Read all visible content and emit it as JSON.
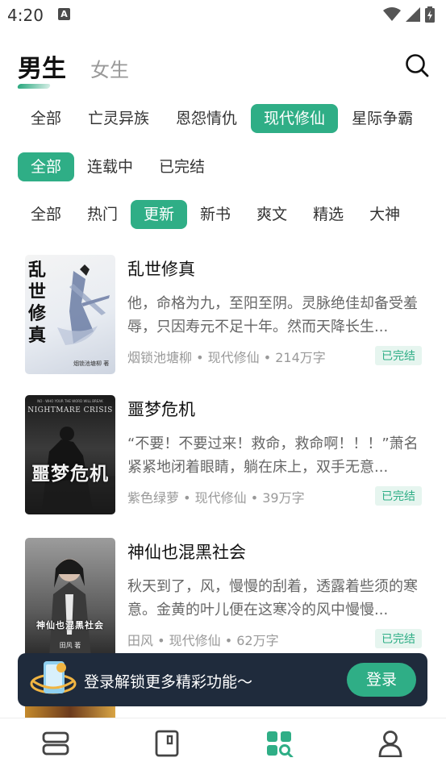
{
  "status_bar": {
    "time": "4:20",
    "notification_icon": "A"
  },
  "gender_tabs": {
    "male": "男生",
    "female": "女生"
  },
  "category_chips": [
    "全部",
    "亡灵异族",
    "恩怨情仇",
    "现代修仙",
    "星际争霸"
  ],
  "category_active_index": 3,
  "status_chips": [
    "全部",
    "连载中",
    "已完结"
  ],
  "status_active_index": 0,
  "sort_chips": [
    "全部",
    "热门",
    "更新",
    "新书",
    "爽文",
    "精选",
    "大神"
  ],
  "sort_active_index": 2,
  "books": [
    {
      "title": "乱世修真",
      "description": "他，命格为九，至阳至阴。灵脉绝佳却备受羞辱，只因寿元不足十年。然而天降长生...",
      "meta": "烟锁池塘柳 • 现代修仙 • 214万字",
      "status": "已完结",
      "cover_calligraphy": "乱世修真",
      "cover_small_text": "烟锁池塘柳 著"
    },
    {
      "title": "噩梦危机",
      "description": "“不要！不要过来！救命，救命啊！！！”萧名紧紧地闭着眼睛，躺在床上，双手无意...",
      "meta": "紫色绿萝 • 现代修仙 • 39万字",
      "status": "已完结",
      "cover_title_en": "NIGHTMARE CRISIS",
      "cover_title_cn": "噩梦危机",
      "cover_tagline": "NO · WHO YOUR THE WORD WILL BREAK"
    },
    {
      "title": "神仙也混黑社会",
      "description": "秋天到了，风，慢慢的刮着，透露着些须的寒意。金黄的叶儿便在这寒冷的风中慢慢...",
      "meta": "田风 • 现代修仙 • 62万字",
      "status": "已完结",
      "cover_title_cn": "神仙也混黑社会",
      "cover_small_text": "田风 著"
    }
  ],
  "login_banner": {
    "text": "登录解锁更多精彩功能～",
    "button": "登录"
  },
  "bottom_nav": [
    "bookshelf-icon",
    "bookstore-icon",
    "category-icon",
    "profile-icon"
  ],
  "colors": {
    "accent": "#2fae86",
    "banner_bg": "#1f2b3c"
  }
}
